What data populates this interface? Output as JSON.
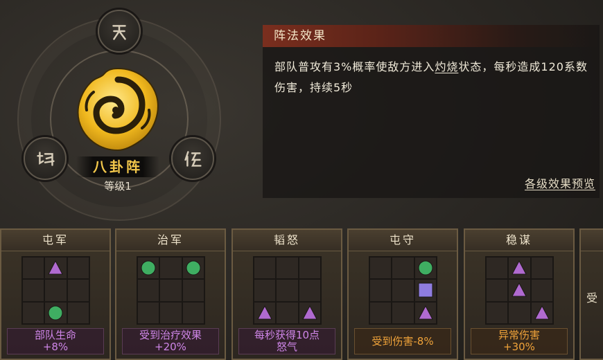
{
  "formation": {
    "name": "八卦阵",
    "level": "等级1"
  },
  "effect_panel": {
    "title": "阵法效果",
    "desc_part1": "部队普攻有3%概率使敌方进入",
    "desc_keyword": "灼烧",
    "desc_part2": "状态，每秒造成120系数伤害，持续5秒",
    "preview_link": "各级效果预览"
  },
  "cards": [
    {
      "title": "屯军",
      "effect_line1": "部队生命",
      "effect_line2": "+8%",
      "effect_style": "purple",
      "grid": [
        "",
        "triangle",
        "",
        "",
        "",
        "",
        "",
        "circle",
        ""
      ]
    },
    {
      "title": "治军",
      "effect_line1": "受到治疗效果",
      "effect_line2": "+20%",
      "effect_style": "purple",
      "grid": [
        "circle",
        "",
        "circle",
        "",
        "",
        "",
        "",
        "",
        ""
      ]
    },
    {
      "title": "韬怒",
      "effect_line1": "每秒获得10点",
      "effect_line2": "怒气",
      "effect_style": "purple",
      "grid": [
        "",
        "",
        "",
        "",
        "",
        "",
        "triangle",
        "",
        "triangle"
      ]
    },
    {
      "title": "屯守",
      "effect_line1": "受到伤害-8%",
      "effect_line2": "",
      "effect_style": "orange",
      "grid": [
        "",
        "",
        "circle",
        "",
        "",
        "square",
        "",
        "",
        "triangle"
      ]
    },
    {
      "title": "稳谋",
      "effect_line1": "异常伤害",
      "effect_line2": "+30%",
      "effect_style": "orange",
      "grid": [
        "",
        "triangle",
        "",
        "",
        "triangle",
        "",
        "",
        "",
        "triangle"
      ]
    }
  ],
  "partial_card": {
    "text": "受"
  },
  "colors": {
    "triangle": "#b06ad0",
    "circle": "#3fae62",
    "square": "#8f7de0",
    "gold": "#f3c84b"
  },
  "icons": {
    "rune_top": "heaven-rune-icon",
    "rune_left": "earth-rune-icon",
    "rune_right": "human-rune-icon",
    "emblem": "taiji-emblem-icon"
  }
}
